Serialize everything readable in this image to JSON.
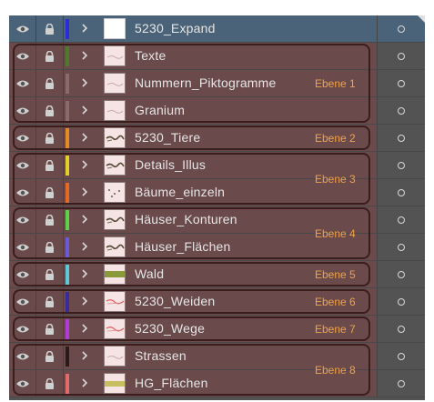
{
  "panel": {
    "accent_selected": "#4b6378",
    "group_border_color": "#3a1d1d",
    "group_label_color": "#f0a24a"
  },
  "layers": [
    {
      "name": "5230_Expand",
      "color": "#2b2bd9",
      "selected": true,
      "thumb": "blank"
    },
    {
      "name": "Texte",
      "color": "#4d7a2b",
      "selected": false,
      "thumb": "faint"
    },
    {
      "name": "Nummern_Piktogramme",
      "color": "#8a6a6a",
      "selected": false,
      "thumb": "faint"
    },
    {
      "name": "Granium",
      "color": "#8a6a6a",
      "selected": false,
      "thumb": "faint"
    },
    {
      "name": "5230_Tiere",
      "color": "#e38a23",
      "selected": false,
      "thumb": "dark"
    },
    {
      "name": "Details_Illus",
      "color": "#e3d02a",
      "selected": false,
      "thumb": "dark"
    },
    {
      "name": "Bäume_einzeln",
      "color": "#e36a23",
      "selected": false,
      "thumb": "dots"
    },
    {
      "name": "Häuser_Konturen",
      "color": "#5ed14a",
      "selected": false,
      "thumb": "dark"
    },
    {
      "name": "Häuser_Flächen",
      "color": "#6a5ad9",
      "selected": false,
      "thumb": "dark"
    },
    {
      "name": "Wald",
      "color": "#5ec8d9",
      "selected": false,
      "thumb": "green"
    },
    {
      "name": "5230_Weiden",
      "color": "#3a2a9a",
      "selected": false,
      "thumb": "red"
    },
    {
      "name": "5230_Wege",
      "color": "#b23ad9",
      "selected": false,
      "thumb": "red"
    },
    {
      "name": "Strassen",
      "color": "#2a1a1a",
      "selected": false,
      "thumb": "faint"
    },
    {
      "name": "HG_Flächen",
      "color": "#e36a6a",
      "selected": false,
      "thumb": "yellow"
    }
  ],
  "groups": [
    {
      "label": "Ebene 1",
      "first": 1,
      "last": 3,
      "label_row": 2
    },
    {
      "label": "Ebene 2",
      "first": 4,
      "last": 4,
      "label_row": 4
    },
    {
      "label": "Ebene 3",
      "first": 5,
      "last": 6,
      "label_row": 5.5
    },
    {
      "label": "Ebene 4",
      "first": 7,
      "last": 8,
      "label_row": 7.5
    },
    {
      "label": "Ebene 5",
      "first": 9,
      "last": 9,
      "label_row": 9
    },
    {
      "label": "Ebene 6",
      "first": 10,
      "last": 10,
      "label_row": 10
    },
    {
      "label": "Ebene 7",
      "first": 11,
      "last": 11,
      "label_row": 11
    },
    {
      "label": "Ebene 8",
      "first": 12,
      "last": 13,
      "label_row": 12.5
    }
  ]
}
